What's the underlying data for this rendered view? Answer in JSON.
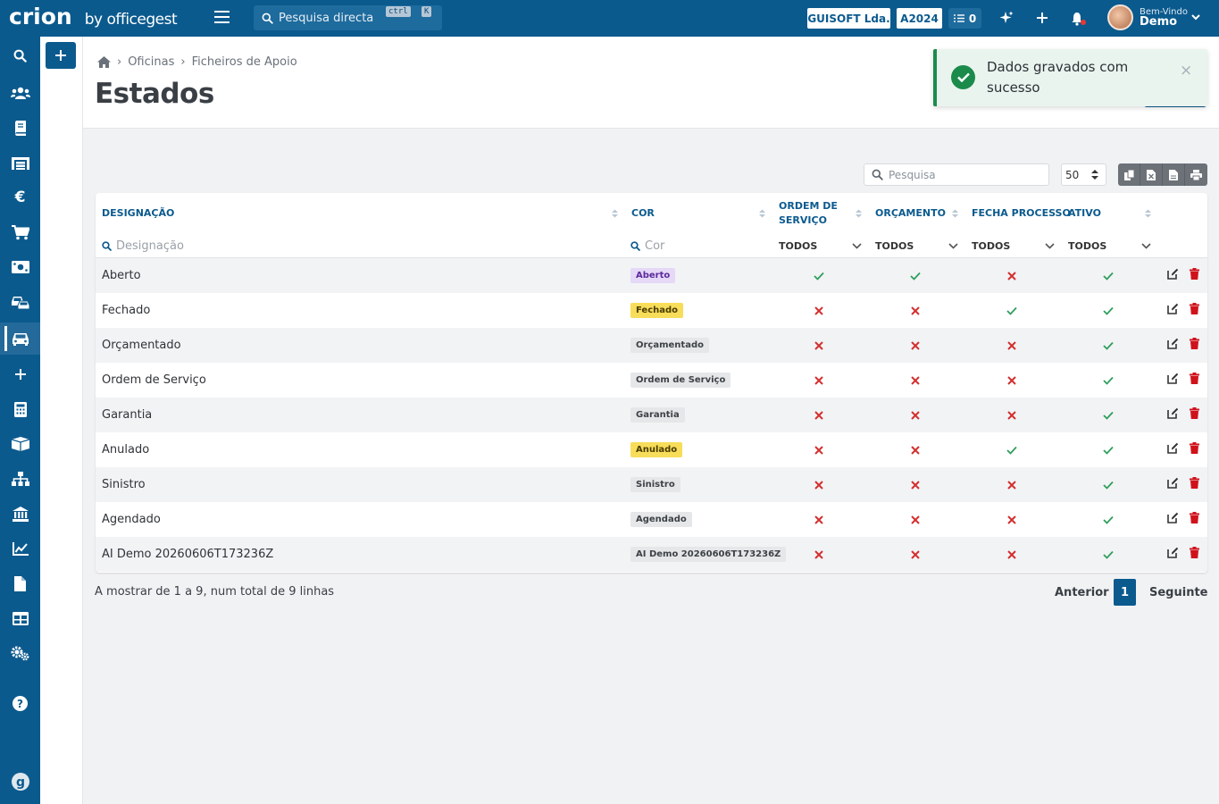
{
  "header": {
    "logo": "crion",
    "logo_suffix": "by officegest",
    "search_placeholder": "Pesquisa directa",
    "shortcut_1": "ctrl",
    "shortcut_2": "K",
    "company": "GUISOFT Lda.",
    "year": "A2024",
    "tasks_count": "0",
    "welcome": "Bem-Vindo",
    "user": "Demo"
  },
  "breadcrumb": [
    "Oficinas",
    "Ficheiros de Apoio"
  ],
  "page_title": "Estados",
  "toast": {
    "message": "Dados gravados com sucesso"
  },
  "toolbar": {
    "search_placeholder": "Pesquisa",
    "page_size": "50"
  },
  "table": {
    "columns": [
      "DESIGNAÇÃO",
      "COR",
      "ORDEM DE SERVIÇO",
      "ORÇAMENTO",
      "FECHA PROCESSO",
      "ATIVO"
    ],
    "filters": {
      "designacao_placeholder": "Designação",
      "cor_placeholder": "Cor",
      "all": "TODOS"
    },
    "rows": [
      {
        "name": "Aberto",
        "badge": "Aberto",
        "badge_bg": "#e5d9f7",
        "badge_fg": "#5b2a9c",
        "os": true,
        "orc": true,
        "fecha": false,
        "ativo": true
      },
      {
        "name": "Fechado",
        "badge": "Fechado",
        "badge_bg": "#f7dd5a",
        "badge_fg": "#4a3b00",
        "os": false,
        "orc": false,
        "fecha": true,
        "ativo": true
      },
      {
        "name": "Orçamentado",
        "badge": "Orçamentado",
        "badge_bg": "#e6e7e9",
        "badge_fg": "#3d4146",
        "os": false,
        "orc": false,
        "fecha": false,
        "ativo": true
      },
      {
        "name": "Ordem de Serviço",
        "badge": "Ordem de Serviço",
        "badge_bg": "#e6e7e9",
        "badge_fg": "#3d4146",
        "os": false,
        "orc": false,
        "fecha": false,
        "ativo": true
      },
      {
        "name": "Garantia",
        "badge": "Garantia",
        "badge_bg": "#e6e7e9",
        "badge_fg": "#3d4146",
        "os": false,
        "orc": false,
        "fecha": false,
        "ativo": true
      },
      {
        "name": "Anulado",
        "badge": "Anulado",
        "badge_bg": "#f7dd5a",
        "badge_fg": "#4a3b00",
        "os": false,
        "orc": false,
        "fecha": true,
        "ativo": true
      },
      {
        "name": "Sinistro",
        "badge": "Sinistro",
        "badge_bg": "#e6e7e9",
        "badge_fg": "#3d4146",
        "os": false,
        "orc": false,
        "fecha": false,
        "ativo": true
      },
      {
        "name": "Agendado",
        "badge": "Agendado",
        "badge_bg": "#e6e7e9",
        "badge_fg": "#3d4146",
        "os": false,
        "orc": false,
        "fecha": false,
        "ativo": true
      },
      {
        "name": "AI Demo 20260606T173236Z",
        "badge": "AI Demo 20260606T173236Z",
        "badge_bg": "#e6e7e9",
        "badge_fg": "#3d4146",
        "os": false,
        "orc": false,
        "fecha": false,
        "ativo": true
      }
    ]
  },
  "footer": {
    "info": "A mostrar de 1 a 9, num total de 9 linhas",
    "prev": "Anterior",
    "page": "1",
    "next": "Seguinte"
  },
  "colors": {
    "primary": "#0b5a8e",
    "check": "#2e9e5b",
    "cross": "#d32f2f",
    "delete": "#d0121b"
  }
}
